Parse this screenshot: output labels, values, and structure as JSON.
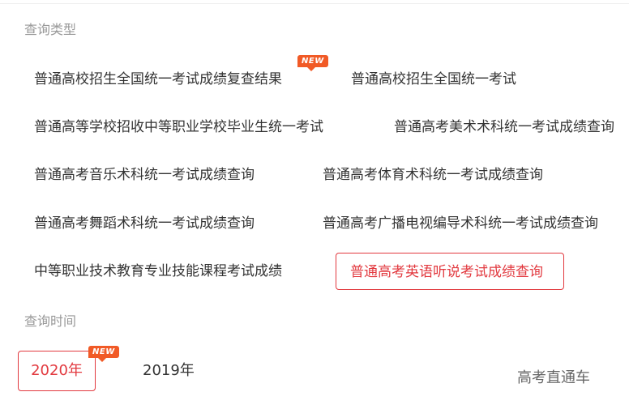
{
  "query_type": {
    "label": "查询类型",
    "items": [
      "普通高校招生全国统一考试成绩复查结果",
      "普通高校招生全国统一考试",
      "普通高等学校招收中等职业学校毕业生统一考试",
      "普通高考美术术科统一考试成绩查询",
      "普通高考音乐术科统一考试成绩查询",
      "普通高考体育术科统一考试成绩查询",
      "普通高考舞蹈术科统一考试成绩查询",
      "普通高考广播电视编导术科统一考试成绩查询",
      "中等职业技术教育专业技能课程考试成绩",
      "普通高考英语听说考试成绩查询"
    ],
    "selected_index": 9,
    "new_badge": "NEW"
  },
  "query_time": {
    "label": "查询时间",
    "years": [
      "2020年",
      "2019年"
    ],
    "selected_index": 0,
    "new_badge": "NEW"
  },
  "corner_link": "高考直通车",
  "colors": {
    "accent": "#e2393f",
    "badge": "#f15a26",
    "label": "#999999",
    "text": "#333333"
  }
}
